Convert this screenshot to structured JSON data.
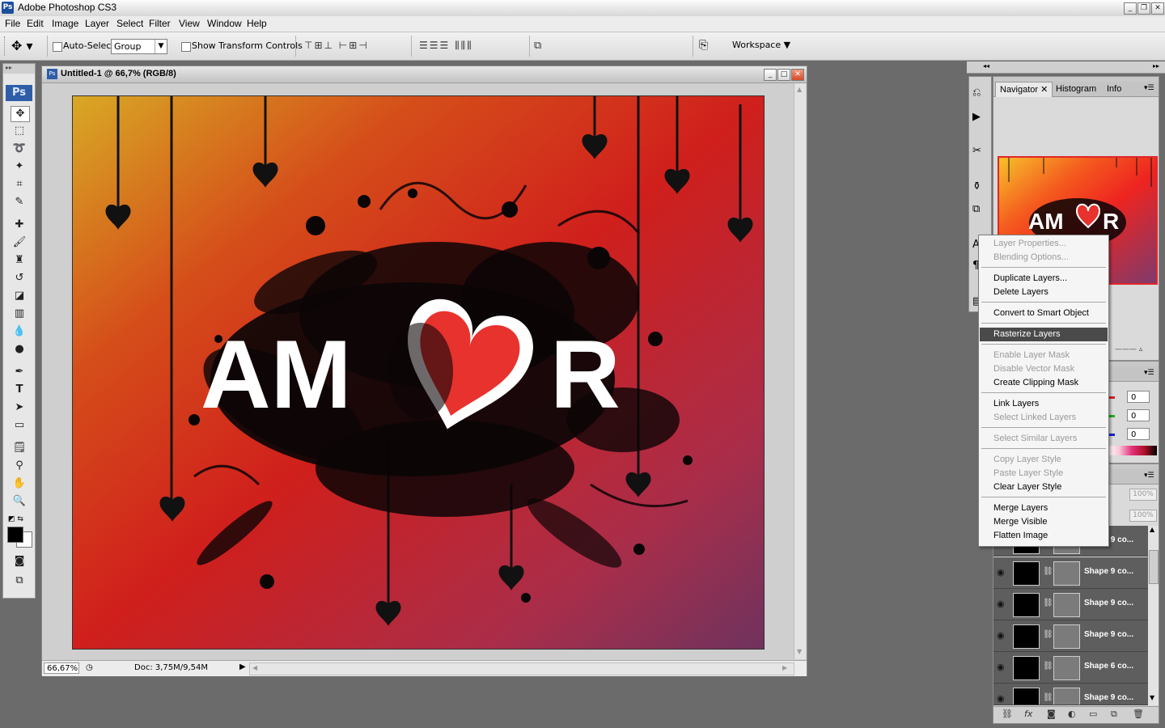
{
  "app": {
    "title": "Adobe Photoshop CS3",
    "icon_label": "Ps"
  },
  "menu": [
    "File",
    "Edit",
    "Image",
    "Layer",
    "Select",
    "Filter",
    "View",
    "Window",
    "Help"
  ],
  "options": {
    "auto_select_label": "Auto-Select:",
    "auto_select_value": "Group",
    "show_transform_label": "Show Transform Controls",
    "workspace_label": "Workspace"
  },
  "toolbox": {
    "logo": "Ps"
  },
  "document": {
    "title": "Untitled-1 @ 66,7% (RGB/8)",
    "zoom": "66,67%",
    "doc_info": "Doc: 3,75M/9,54M",
    "artwork_text": "AM",
    "artwork_text_end": "R"
  },
  "navigator": {
    "tabs": [
      "Navigator",
      "Histogram",
      "Info"
    ]
  },
  "color_panel": {
    "r": "0",
    "g": "0",
    "b": "0"
  },
  "layers_panel": {
    "opacity": "100%",
    "fill": "100%",
    "rows": [
      {
        "name": "Shape 9 co..."
      },
      {
        "name": "Shape 9 co..."
      },
      {
        "name": "Shape 9 co..."
      },
      {
        "name": "Shape 9 co..."
      },
      {
        "name": "Shape 6 co..."
      },
      {
        "name": "Shape 9 co..."
      }
    ]
  },
  "context_menu": {
    "items": [
      {
        "label": "Layer Properties...",
        "disabled": true
      },
      {
        "label": "Blending Options...",
        "disabled": true
      },
      {
        "label": "Duplicate Layers...",
        "disabled": false
      },
      {
        "label": "Delete Layers",
        "disabled": false
      },
      {
        "label": "Convert to Smart Object",
        "disabled": false
      },
      {
        "label": "Rasterize Layers",
        "disabled": false,
        "selected": true
      },
      {
        "label": "Enable Layer Mask",
        "disabled": true
      },
      {
        "label": "Disable Vector Mask",
        "disabled": true
      },
      {
        "label": "Create Clipping Mask",
        "disabled": false
      },
      {
        "label": "Link Layers",
        "disabled": false
      },
      {
        "label": "Select Linked Layers",
        "disabled": true
      },
      {
        "label": "Select Similar Layers",
        "disabled": true
      },
      {
        "label": "Copy Layer Style",
        "disabled": true
      },
      {
        "label": "Paste Layer Style",
        "disabled": true
      },
      {
        "label": "Clear Layer Style",
        "disabled": false
      },
      {
        "label": "Merge Layers",
        "disabled": false
      },
      {
        "label": "Merge Visible",
        "disabled": false
      },
      {
        "label": "Flatten Image",
        "disabled": false
      }
    ]
  },
  "colors": {
    "canvas_red": "#f0231c",
    "canvas_yellow": "#f7c12a",
    "canvas_purple": "#8a3c6a",
    "heart_red": "#e8322d",
    "selection": "#4a4a4a"
  }
}
